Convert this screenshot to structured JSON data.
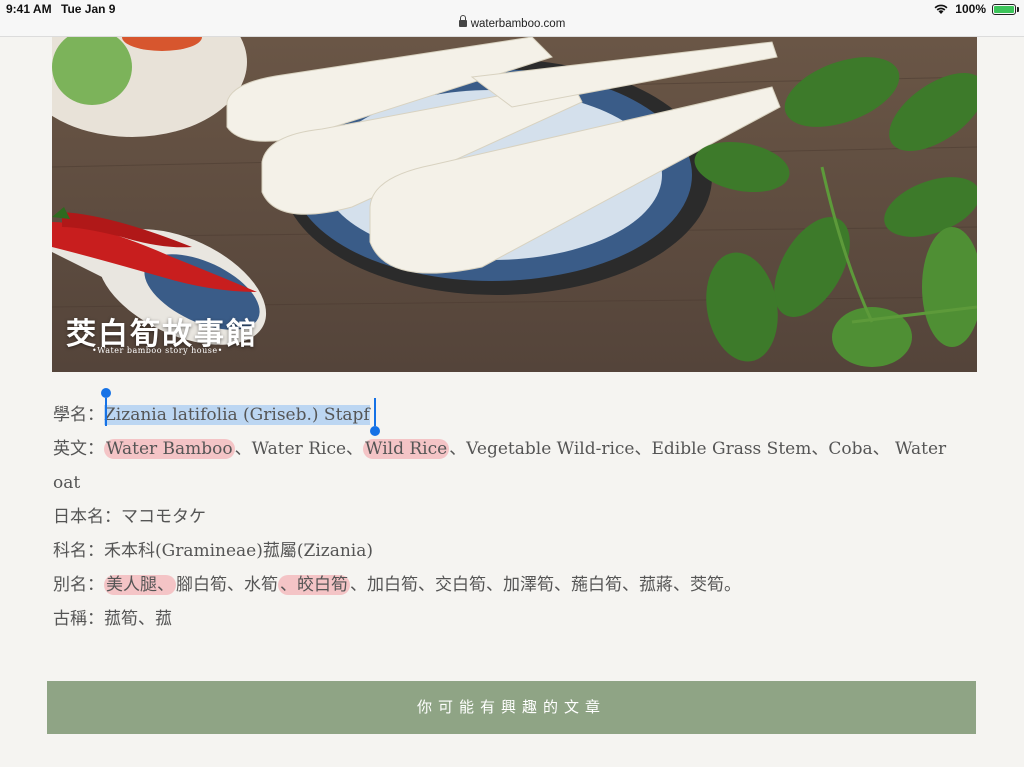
{
  "status": {
    "time": "9:41 AM",
    "date": "Tue Jan 9",
    "url": "waterbamboo.com",
    "battery": "100%"
  },
  "hero": {
    "title": "茭白筍故事館",
    "subtitle": "•Water bamboo story house•"
  },
  "info": {
    "scientific_label": "學名：",
    "scientific_value": "Zizania latifolia (Griseb.) Stapf",
    "english_label": "英文：",
    "english_parts": [
      "Water Bamboo",
      "、Water Rice、",
      "Wild Rice",
      "、Vegetable Wild-rice、Edible Grass Stem、Coba、 Water"
    ],
    "english_cont": "oat",
    "japanese_label": "日本名：",
    "japanese_value": "マコモタケ",
    "family_label": "科名：",
    "family_value": "禾本科(Gramineae)菰屬(Zizania)",
    "alias_label": "別名：",
    "alias_parts": [
      "美人腿、",
      "腳白筍、水筍",
      "、皎白筍",
      "、加白筍、交白筍、加澤筍、葹白筍、菰蔣、茭筍。"
    ],
    "ancient_label": "古稱：",
    "ancient_value": "菰筍、菰"
  },
  "related_label": "你可能有興趣的文章",
  "colors": {
    "highlight": "#f4c4c6",
    "selection": "#bcd6f2",
    "related_bg": "#8fa485"
  }
}
